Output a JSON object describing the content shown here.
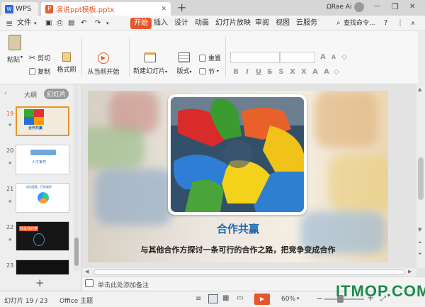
{
  "titlebar": {
    "app_tab": "WPS",
    "doc_tab": "演说ppt模板.pptx",
    "new_tab": "+",
    "user": "ΩRae Ai",
    "minimize": "—",
    "restore": "❐",
    "close": "✕"
  },
  "menu": {
    "file": "文件",
    "items": [
      "开始",
      "插入",
      "设计",
      "动画",
      "幻灯片放映",
      "审阅",
      "视图",
      "云服务"
    ],
    "search": "查找命令...",
    "help": "?"
  },
  "ribbon": {
    "paste": "粘贴",
    "cut": "剪切",
    "copy": "复制",
    "format_painter": "格式刷",
    "from_current": "从当前开始",
    "new_slide": "新建幻灯片",
    "layout": "版式",
    "reset": "重置",
    "section": "节"
  },
  "panel": {
    "outline_tab": "大纲",
    "slides_tab": "幻灯片",
    "slides": [
      {
        "num": "19",
        "title": "合作共赢"
      },
      {
        "num": "20",
        "title": "人才争夺"
      },
      {
        "num": "21",
        "title": "成功要素、目标路径"
      },
      {
        "num": "22",
        "title": "我是我的梦"
      },
      {
        "num": "23",
        "title": ""
      }
    ],
    "add": "+"
  },
  "slide": {
    "title": "合作共赢",
    "subtitle": "与其他合作方探讨一条可行的合作之路，把竞争变成合作"
  },
  "notes": {
    "placeholder": "单击此处添加备注"
  },
  "status": {
    "slide_counter": "幻灯片 19 / 23",
    "theme": "Office 主题",
    "zoom": "60%",
    "zoom_minus": "−",
    "zoom_plus": "+"
  },
  "watermark": "ITMOP.COM",
  "colors": {
    "accent": "#e6562b",
    "title_blue": "#1d68b4",
    "watermark": "#1e8a4d"
  }
}
